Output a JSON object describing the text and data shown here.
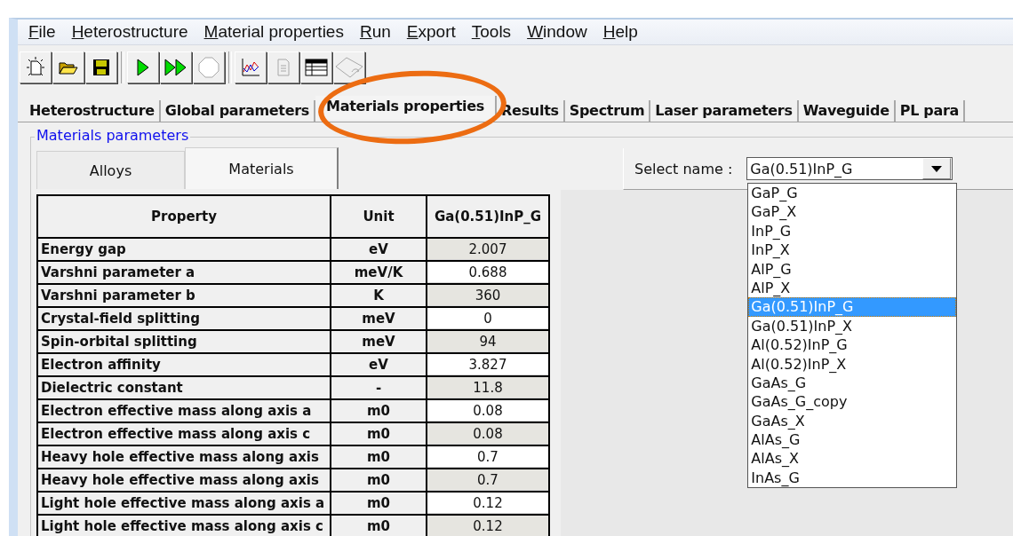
{
  "menu": [
    {
      "label": "File"
    },
    {
      "label": "Heterostructure"
    },
    {
      "label": "Material properties"
    },
    {
      "label": "Run"
    },
    {
      "label": "Export"
    },
    {
      "label": "Tools"
    },
    {
      "label": "Window"
    },
    {
      "label": "Help"
    }
  ],
  "toolbar": [
    {
      "buttons": [
        {
          "kind": "new",
          "disabled": false
        },
        {
          "kind": "open",
          "disabled": false
        },
        {
          "kind": "save",
          "disabled": false
        }
      ]
    },
    {
      "buttons": [
        {
          "kind": "run",
          "disabled": false
        },
        {
          "kind": "run_all",
          "disabled": false
        },
        {
          "kind": "stop",
          "disabled": true
        }
      ]
    },
    {
      "buttons": [
        {
          "kind": "chart",
          "disabled": false
        },
        {
          "kind": "document",
          "disabled": true
        },
        {
          "kind": "table",
          "disabled": false
        },
        {
          "kind": "export",
          "disabled": true
        }
      ]
    }
  ],
  "tabs": [
    {
      "label": "Heterostructure",
      "selected": false
    },
    {
      "label": "Global parameters",
      "selected": false
    },
    {
      "label": "Materials properties",
      "selected": true
    },
    {
      "label": "Results",
      "selected": false
    },
    {
      "label": "Spectrum",
      "selected": false
    },
    {
      "label": "Laser parameters",
      "selected": false
    },
    {
      "label": "Waveguide",
      "selected": false
    },
    {
      "label": "PL para",
      "selected": false
    }
  ],
  "group": {
    "title": "Materials parameters"
  },
  "subtabs": [
    {
      "label": "Alloys",
      "selected": false
    },
    {
      "label": "Materials",
      "selected": true
    }
  ],
  "table": {
    "columns": [
      "Property",
      "Unit",
      "Ga(0.51)InP_G"
    ],
    "rows": [
      {
        "property": "Energy gap",
        "unit": "eV",
        "value": "2.007"
      },
      {
        "property": "Varshni parameter a",
        "unit": "meV/K",
        "value": "0.688"
      },
      {
        "property": "Varshni parameter b",
        "unit": "K",
        "value": "360"
      },
      {
        "property": "Crystal-field splitting",
        "unit": "meV",
        "value": "0"
      },
      {
        "property": "Spin-orbital splitting",
        "unit": "meV",
        "value": "94"
      },
      {
        "property": "Electron affinity",
        "unit": "eV",
        "value": "3.827"
      },
      {
        "property": "Dielectric constant",
        "unit": "-",
        "value": "11.8"
      },
      {
        "property": "Electron effective mass along axis a",
        "unit": "m0",
        "value": "0.08"
      },
      {
        "property": "Electron effective mass along axis c",
        "unit": "m0",
        "value": "0.08"
      },
      {
        "property": "Heavy hole effective mass along axis",
        "unit": "m0",
        "value": "0.7"
      },
      {
        "property": "Heavy hole effective mass along axis",
        "unit": "m0",
        "value": "0.7"
      },
      {
        "property": "Light hole effective mass along axis a",
        "unit": "m0",
        "value": "0.12"
      },
      {
        "property": "Light hole effective mass along axis c",
        "unit": "m0",
        "value": "0.12"
      }
    ]
  },
  "select": {
    "label": "Select name :",
    "value": "Ga(0.51)InP_G",
    "expanded": true,
    "options": [
      {
        "label": "GaP_G",
        "selected": false
      },
      {
        "label": "GaP_X",
        "selected": false
      },
      {
        "label": "InP_G",
        "selected": false
      },
      {
        "label": "InP_X",
        "selected": false
      },
      {
        "label": "AlP_G",
        "selected": false
      },
      {
        "label": "AlP_X",
        "selected": false
      },
      {
        "label": "Ga(0.51)InP_G",
        "selected": true
      },
      {
        "label": "Ga(0.51)InP_X",
        "selected": false
      },
      {
        "label": "Al(0.52)InP_G",
        "selected": false
      },
      {
        "label": "Al(0.52)InP_X",
        "selected": false
      },
      {
        "label": "GaAs_G",
        "selected": false
      },
      {
        "label": "GaAs_G_copy",
        "selected": false
      },
      {
        "label": "GaAs_X",
        "selected": false
      },
      {
        "label": "AlAs_G",
        "selected": false
      },
      {
        "label": "AlAs_X",
        "selected": false
      },
      {
        "label": "InAs_G",
        "selected": false
      }
    ]
  }
}
